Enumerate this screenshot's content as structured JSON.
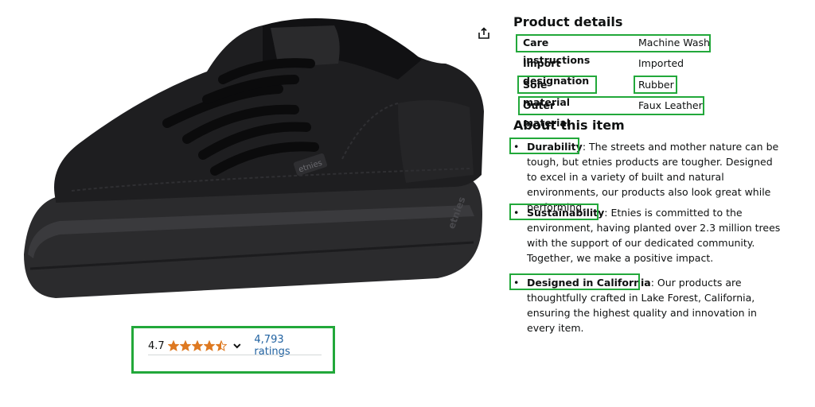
{
  "product": {
    "share_icon": "share-icon",
    "image_alt": "Black etnies skate shoe",
    "logo_text": "etnies"
  },
  "rating": {
    "value": "4.7",
    "stars": 4.5,
    "ratings_text": "4,793 ratings",
    "star_color": "#de7921"
  },
  "details": {
    "title": "Product details",
    "rows": [
      {
        "key": "Care instructions",
        "value": "Machine Wash",
        "highlighted": true
      },
      {
        "key": "Import designation",
        "value": "Imported",
        "highlighted": false
      },
      {
        "key": "Sole material",
        "value": "Rubber",
        "highlighted": true
      },
      {
        "key": "Outer material",
        "value": "Faux Leather",
        "highlighted": true
      }
    ]
  },
  "about": {
    "title": "About this item",
    "bullets": [
      {
        "label": "Durability",
        "text": ": The streets and mother nature can be tough, but etnies products are tougher. Designed to excel in a variety of built and natural environments, our products also look great while performing."
      },
      {
        "label": "Sustainability",
        "text": ": Etnies is committed to the environment, having planted over 2.3 million trees with the support of our dedicated community. Together, we make a positive impact."
      },
      {
        "label": "Designed in California",
        "text": ": Our products are thoughtfully crafted in Lake Forest, California, ensuring the highest quality and innovation in every item."
      }
    ]
  },
  "colors": {
    "highlight": "#22a83a",
    "link": "#2162a1"
  }
}
